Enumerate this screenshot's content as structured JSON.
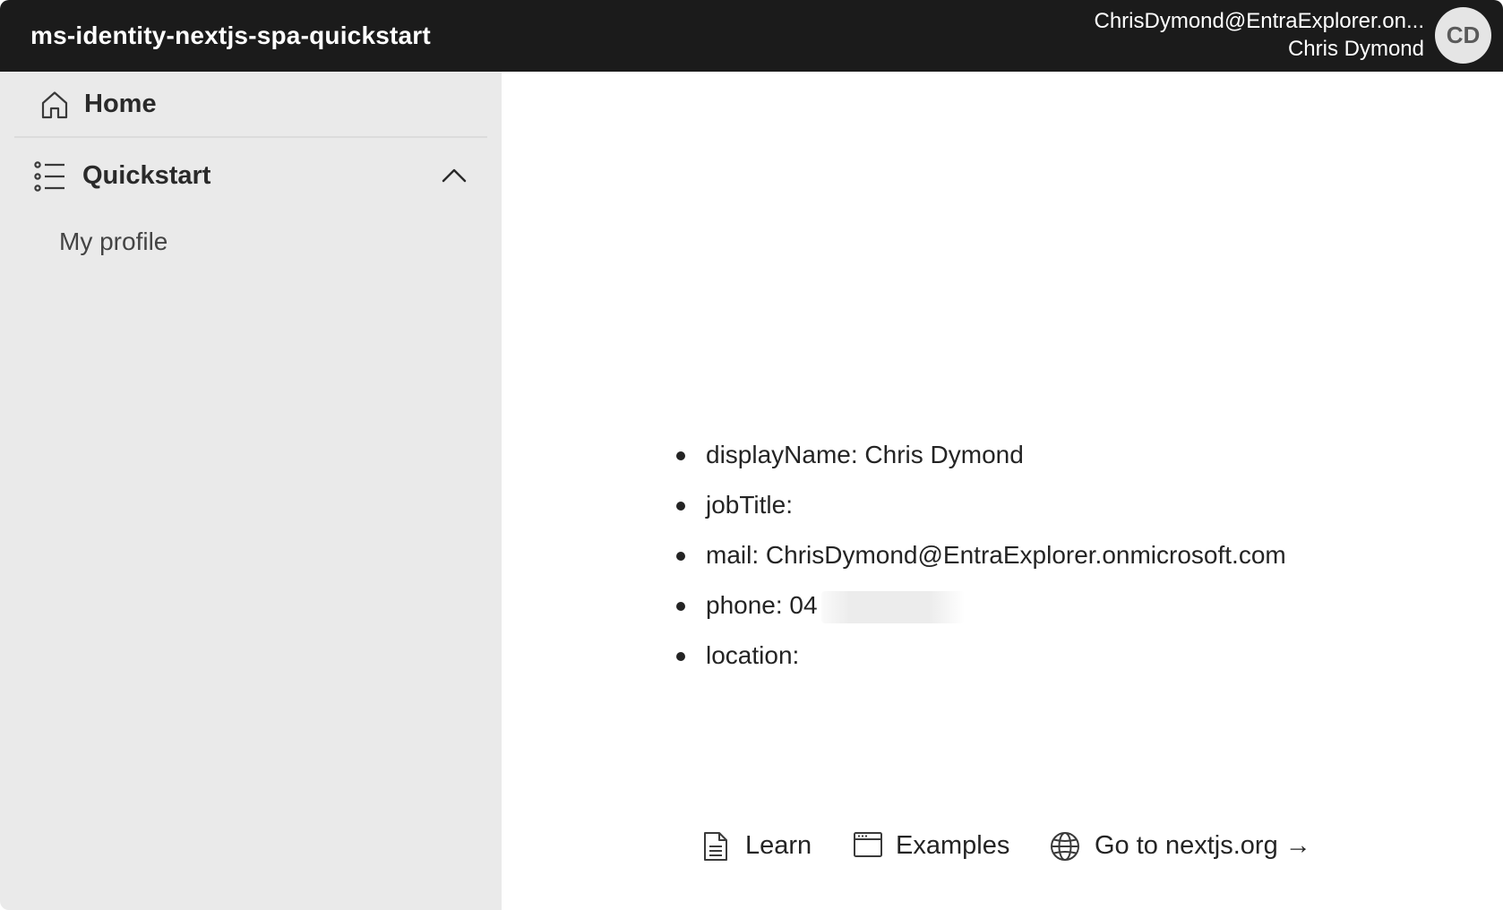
{
  "header": {
    "title": "ms-identity-nextjs-spa-quickstart",
    "account_email": "ChrisDymond@EntraExplorer.on...",
    "account_name": "Chris Dymond",
    "avatar_initials": "CD"
  },
  "sidebar": {
    "home": {
      "label": "Home",
      "icon": "home-icon"
    },
    "quickstart": {
      "label": "Quickstart",
      "icon": "list-icon",
      "expanded": true
    },
    "sub_items": [
      {
        "label": "My profile"
      }
    ]
  },
  "profile": {
    "fields": [
      {
        "text": "displayName: Chris Dymond"
      },
      {
        "text": "jobTitle:"
      },
      {
        "text": "mail: ChrisDymond@EntraExplorer.onmicrosoft.com"
      },
      {
        "text": "phone: 04"
      },
      {
        "text": "location:"
      }
    ]
  },
  "footer": {
    "learn": {
      "label": "Learn",
      "icon": "document-icon"
    },
    "examples": {
      "label": "Examples",
      "icon": "window-icon"
    },
    "nextjs": {
      "label": "Go to nextjs.org →",
      "icon": "globe-icon"
    }
  }
}
